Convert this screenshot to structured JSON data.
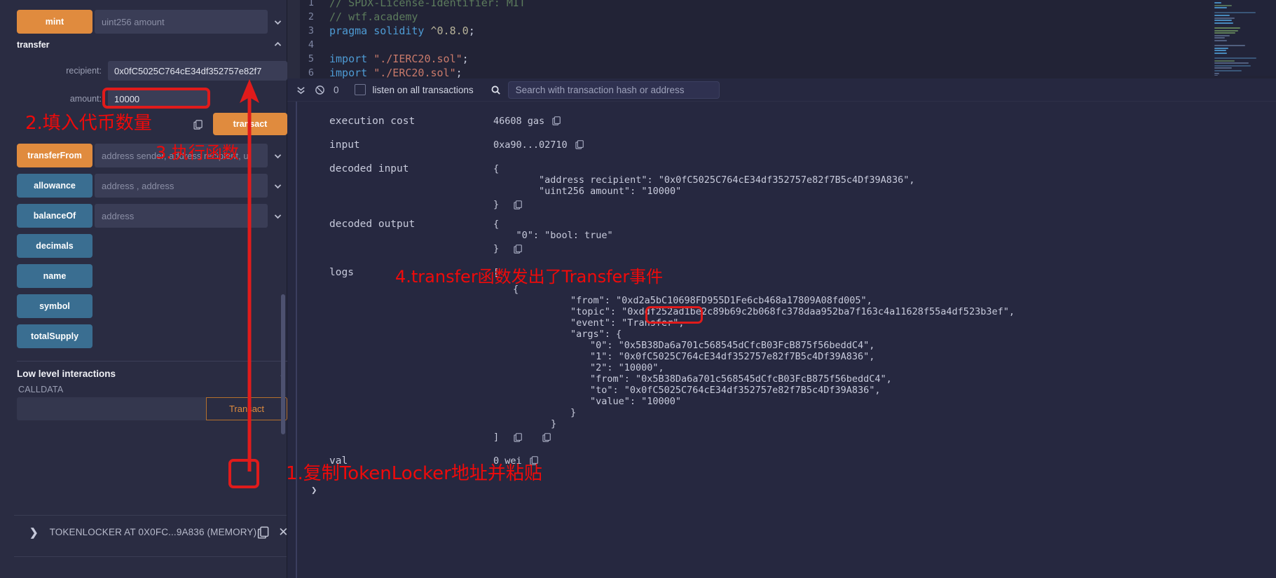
{
  "left_panel": {
    "functions": [
      {
        "name": "mint",
        "style": "orange",
        "placeholder": "uint256 amount",
        "has_caret": true,
        "caret": "down"
      },
      {
        "name": "transferFrom",
        "style": "orange",
        "placeholder": "address sender, address recipient, ui",
        "has_caret": true,
        "caret": "down"
      },
      {
        "name": "allowance",
        "style": "blue",
        "placeholder": "address , address",
        "has_caret": true,
        "caret": "down"
      },
      {
        "name": "balanceOf",
        "style": "blue",
        "placeholder": "address",
        "has_caret": true,
        "caret": "down"
      },
      {
        "name": "decimals",
        "style": "blue",
        "placeholder": "",
        "has_caret": false,
        "caret": ""
      },
      {
        "name": "name",
        "style": "blue",
        "placeholder": "",
        "has_caret": false,
        "caret": ""
      },
      {
        "name": "symbol",
        "style": "blue",
        "placeholder": "",
        "has_caret": false,
        "caret": ""
      },
      {
        "name": "totalSupply",
        "style": "blue",
        "placeholder": "",
        "has_caret": false,
        "caret": ""
      }
    ],
    "transfer_form": {
      "title": "transfer",
      "collapse_caret": "up",
      "recipient_label": "recipient:",
      "recipient_value": "0x0fC5025C764cE34df352757e82f7",
      "amount_label": "amount:",
      "amount_value": "10000",
      "copy_icon": "copy-icon",
      "transact_label": "transact"
    },
    "low_level": {
      "title": "Low level interactions",
      "info_icon": "info-icon",
      "calldata_label": "CALLDATA",
      "calldata_value": "",
      "transact_label": "Transact"
    },
    "deployed": {
      "expand_icon": "chevron-right-icon",
      "label": "TOKENLOCKER AT 0X0FC...9A836 (MEMORY)",
      "copy_icon": "copy-icon",
      "close_icon": "close-icon"
    }
  },
  "editor": {
    "lines": [
      {
        "n": "1",
        "segments": [
          {
            "t": "// SPDX-License-Identifier: MIT",
            "c": "c-comment"
          }
        ]
      },
      {
        "n": "2",
        "segments": [
          {
            "t": "// wtf.academy",
            "c": "c-comment"
          }
        ]
      },
      {
        "n": "3",
        "segments": [
          {
            "t": "pragma ",
            "c": "c-key"
          },
          {
            "t": "solidity ",
            "c": "c-key"
          },
          {
            "t": "^0.8.0",
            "c": "c-num"
          },
          {
            "t": ";",
            "c": "c-punc"
          }
        ]
      },
      {
        "n": "4",
        "segments": [
          {
            "t": "",
            "c": "c-punc"
          }
        ]
      },
      {
        "n": "5",
        "segments": [
          {
            "t": "import ",
            "c": "c-key"
          },
          {
            "t": "\"./IERC20.sol\"",
            "c": "c-str"
          },
          {
            "t": ";",
            "c": "c-punc"
          }
        ]
      },
      {
        "n": "6",
        "segments": [
          {
            "t": "import ",
            "c": "c-key"
          },
          {
            "t": "\"./ERC20.sol\"",
            "c": "c-str"
          },
          {
            "t": ";",
            "c": "c-punc"
          }
        ]
      }
    ]
  },
  "terminal": {
    "toolbar": {
      "collapse_icon": "chevrons-down-icon",
      "clear_icon": "ban-icon",
      "count": "0",
      "listen_label": "listen on all transactions",
      "listen_checked": false,
      "search_icon": "search-icon",
      "search_placeholder": "Search with transaction hash or address",
      "search_value": ""
    },
    "rows": [
      {
        "key": "execution cost",
        "value": "46608 gas",
        "copy": true
      },
      {
        "key": "input",
        "value": "0xa90...02710",
        "copy": true
      }
    ],
    "decoded_input": {
      "key": "decoded input",
      "open": "{",
      "lines": [
        "        \"address recipient\": \"0x0fC5025C764cE34df352757e82f7B5c4Df39A836\",",
        "        \"uint256 amount\": \"10000\""
      ],
      "close": "}",
      "copy": true
    },
    "decoded_output": {
      "key": "decoded output",
      "open": "{",
      "lines": [
        "    \"0\": \"bool: true\""
      ],
      "close": "}",
      "copy": true
    },
    "logs": {
      "key": "logs",
      "open": "[",
      "brace_open": "{",
      "lines": [
        "\"from\": \"0xd2a5bC10698FD955D1Fe6cb468a17809A08fd005\",",
        "\"topic\": \"0xddf252ad1be2c89b69c2b068fc378daa952ba7f163c4a11628f55a4df523b3ef\",",
        "\"event\": \"Transfer\",",
        "\"args\": {"
      ],
      "event_name": "\"Transfer\"",
      "args": [
        "\"0\": \"0x5B38Da6a701c568545dCfcB03FcB875f56beddC4\",",
        "\"1\": \"0x0fC5025C764cE34df352757e82f7B5c4Df39A836\",",
        "\"2\": \"10000\",",
        "\"from\": \"0x5B38Da6a701c568545dCfcB03FcB875f56beddC4\",",
        "\"to\": \"0x0fC5025C764cE34df352757e82f7B5c4Df39A836\",",
        "\"value\": \"10000\""
      ],
      "args_close": "}",
      "brace_close": "}",
      "close": "]",
      "copy": true
    },
    "val_row": {
      "key": "val",
      "value": "0 wei",
      "copy": true
    }
  },
  "annotations": {
    "step1": "1.复制TokenLocker地址并粘贴",
    "step2": "2.填入代币数量",
    "step3": "3.执行函数",
    "step4": "4.transfer函数发出了Transfer事件"
  },
  "colors": {
    "accent_orange": "#e08b3e",
    "accent_blue": "#3a6e91",
    "annotation_red": "#f00a0a",
    "panel_bg": "#2a2c42",
    "terminal_bg": "#262840"
  }
}
